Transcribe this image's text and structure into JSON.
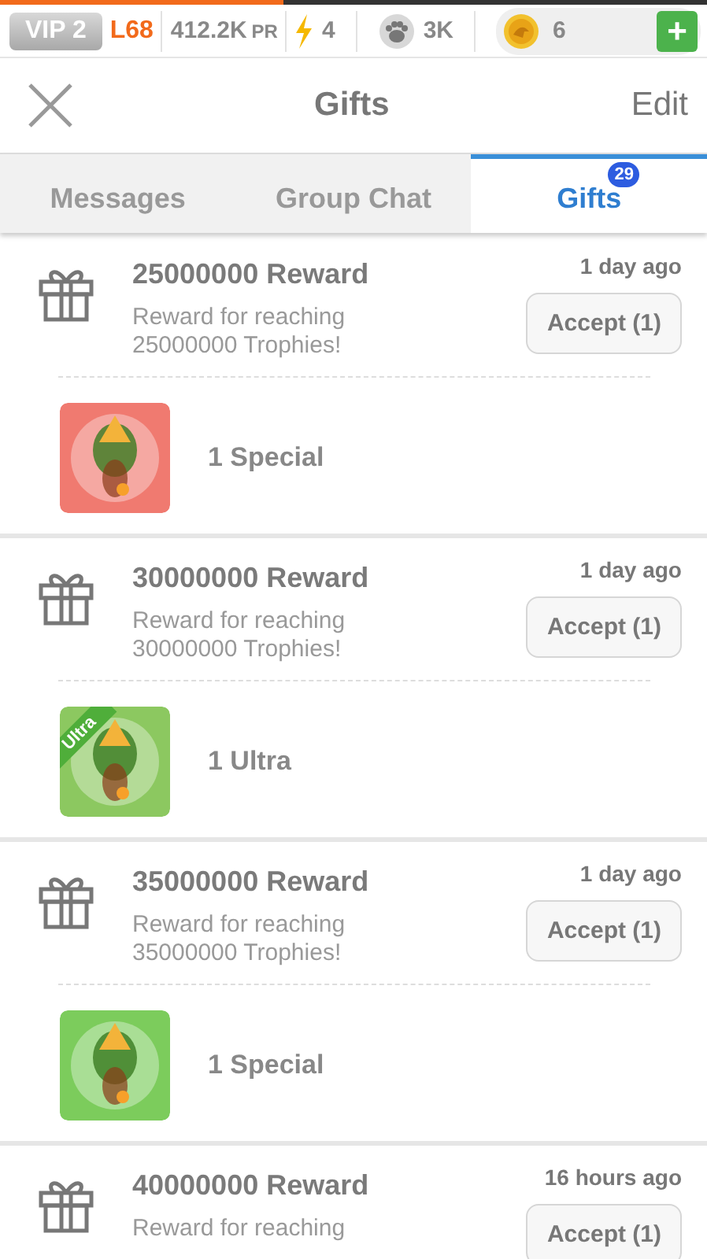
{
  "status_bar": {
    "xp_bar": {
      "level": 0.4
    },
    "vip": "VIP 2",
    "level_label": "L68",
    "power": "412.2K",
    "power_unit": "PR",
    "energy": "4",
    "paws": "3K",
    "coins": "6",
    "add": "+"
  },
  "header": {
    "title": "Gifts",
    "edit": "Edit"
  },
  "tabs": [
    {
      "label": "Messages",
      "selected": false
    },
    {
      "label": "Group Chat",
      "selected": false
    },
    {
      "label": "Gifts",
      "selected": true,
      "badge": "29"
    }
  ],
  "gifts": [
    {
      "title": "25000000 Reward",
      "time": "1 day ago",
      "description": "Reward for reaching 25000000 Trophies!",
      "button": "Accept (1)",
      "item": {
        "label": "1 Special"
      }
    },
    {
      "title": "30000000 Reward",
      "time": "1 day ago",
      "description": "Reward for reaching 30000000 Trophies!",
      "button": "Accept (1)",
      "item": {
        "label": "1 Ultra",
        "ribbon": "Ultra"
      }
    },
    {
      "title": "35000000 Reward",
      "time": "1 day ago",
      "description": "Reward for reaching 35000000 Trophies!",
      "button": "Accept (1)",
      "item": {
        "label": "1 Special"
      }
    },
    {
      "title": "40000000 Reward",
      "time": "16 hours ago",
      "description": "Reward for reaching",
      "button": "Accept (1)"
    }
  ]
}
